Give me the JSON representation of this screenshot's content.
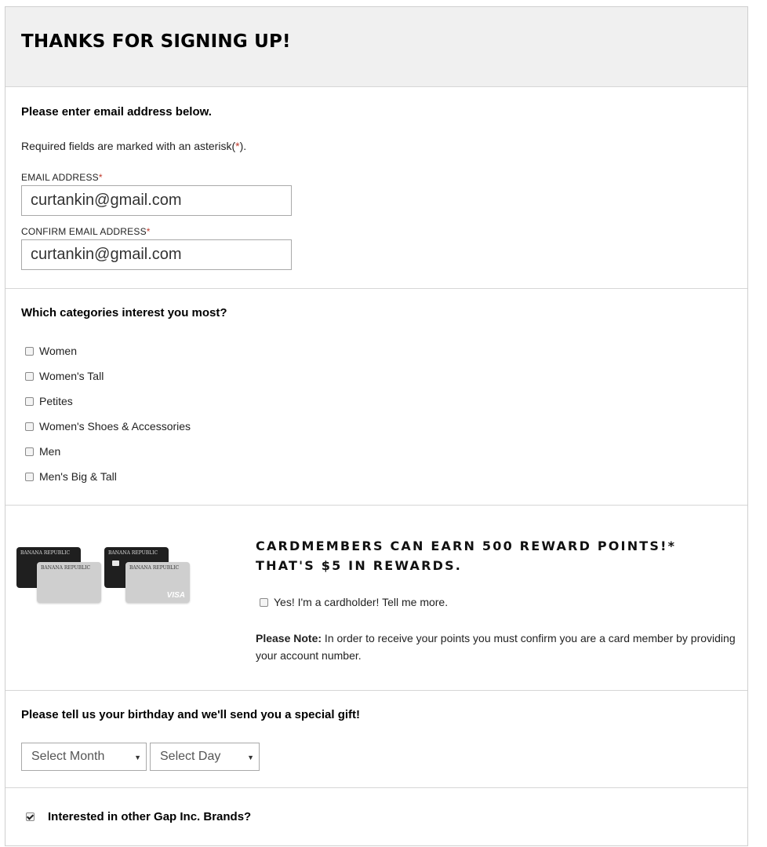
{
  "header": {
    "title": "THANKS FOR SIGNING UP!"
  },
  "email_section": {
    "intro": "Please enter email address below.",
    "required_note_prefix": "Required fields are marked with an asterisk(",
    "required_note_star": "*",
    "required_note_suffix": ").",
    "email_label": "EMAIL ADDRESS",
    "email_value": "curtankin@gmail.com",
    "confirm_label": "CONFIRM EMAIL ADDRESS",
    "confirm_value": "curtankin@gmail.com",
    "asterisk": "*"
  },
  "categories": {
    "question": "Which categories interest you most?",
    "options": [
      {
        "label": "Women",
        "checked": false
      },
      {
        "label": "Women's Tall",
        "checked": false
      },
      {
        "label": "Petites",
        "checked": false
      },
      {
        "label": "Women's Shoes & Accessories",
        "checked": false
      },
      {
        "label": "Men",
        "checked": false
      },
      {
        "label": "Men's Big & Tall",
        "checked": false
      }
    ]
  },
  "cardmember": {
    "card_brand": "BANANA REPUBLIC",
    "card_network": "VISA",
    "headline_line1": "CARDMEMBERS CAN EARN 500 REWARD POINTS!*",
    "headline_line2": "THAT'S $5 IN REWARDS.",
    "checkbox_label": "Yes! I'm a cardholder! Tell me more.",
    "note_bold": "Please Note:",
    "note_text": " In order to receive your points you must confirm you are a card member by providing your account number."
  },
  "birthday": {
    "prompt": "Please tell us your birthday and we'll send you a special gift!",
    "month_selected": "Select Month",
    "day_selected": "Select Day"
  },
  "brands": {
    "label": "Interested in other Gap Inc. Brands?",
    "checked": true
  },
  "colors": {
    "required_star": "#c0392b",
    "header_bg": "#f0f0f0",
    "border": "#d6d6d6"
  }
}
